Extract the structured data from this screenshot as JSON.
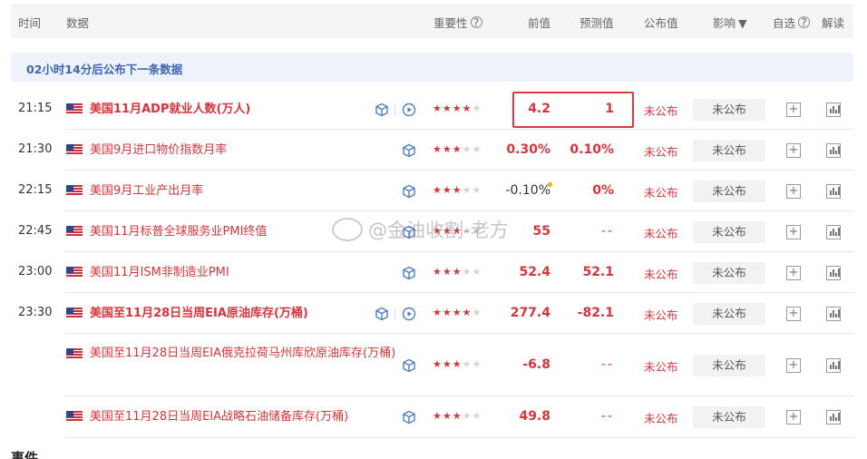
{
  "header": {
    "time": "时间",
    "data": "数据",
    "importance": "重要性",
    "previous": "前值",
    "forecast": "预测值",
    "published": "公布值",
    "impact": "影响",
    "watchlist": "自选",
    "interpret": "解读",
    "help_glyph": "?",
    "caret_glyph": "▼"
  },
  "notice": "02小时14分后公布下一条数据",
  "rows": [
    {
      "time": "21:15",
      "title": "美国11月ADP就业人数(万人)",
      "importance": 4,
      "previous": "4.2",
      "forecast": "1",
      "status": "未公布",
      "impact": "未公布"
    },
    {
      "time": "21:30",
      "title": "美国9月进口物价指数月率",
      "importance": 3,
      "previous": "0.30%",
      "forecast": "0.10%",
      "status": "未公布",
      "impact": "未公布"
    },
    {
      "time": "22:15",
      "title": "美国9月工业产出月率",
      "importance": 3,
      "previous": "-0.10%",
      "forecast": "0%",
      "status": "未公布",
      "impact": "未公布"
    },
    {
      "time": "22:45",
      "title": "美国11月标普全球服务业PMI终值",
      "importance": 3,
      "previous": "55",
      "forecast": "--",
      "status": "未公布",
      "impact": "未公布"
    },
    {
      "time": "23:00",
      "title": "美国11月ISM非制造业PMI",
      "importance": 3,
      "previous": "52.4",
      "forecast": "52.1",
      "status": "未公布",
      "impact": "未公布"
    },
    {
      "time": "23:30",
      "title": "美国至11月28日当周EIA原油库存(万桶)",
      "importance": 4,
      "previous": "277.4",
      "forecast": "-82.1",
      "status": "未公布",
      "impact": "未公布"
    },
    {
      "time": "",
      "title": "美国至11月28日当周EIA俄克拉荷马州库欣原油库存(万桶)",
      "importance": 3,
      "previous": "-6.8",
      "forecast": "--",
      "status": "未公布",
      "impact": "未公布"
    },
    {
      "time": "",
      "title": "美国至11月28日当周EIA战略石油储备库存(万桶)",
      "importance": 3,
      "previous": "49.8",
      "forecast": "--",
      "status": "未公布",
      "impact": "未公布"
    }
  ],
  "icons": {
    "plus": "+"
  },
  "watermark": "@金油收割-老方",
  "footer_title": "事件",
  "colors": {
    "accent_red": "#d8343b",
    "highlight_border": "#e23a3a",
    "notice_text": "#3c64b4"
  }
}
